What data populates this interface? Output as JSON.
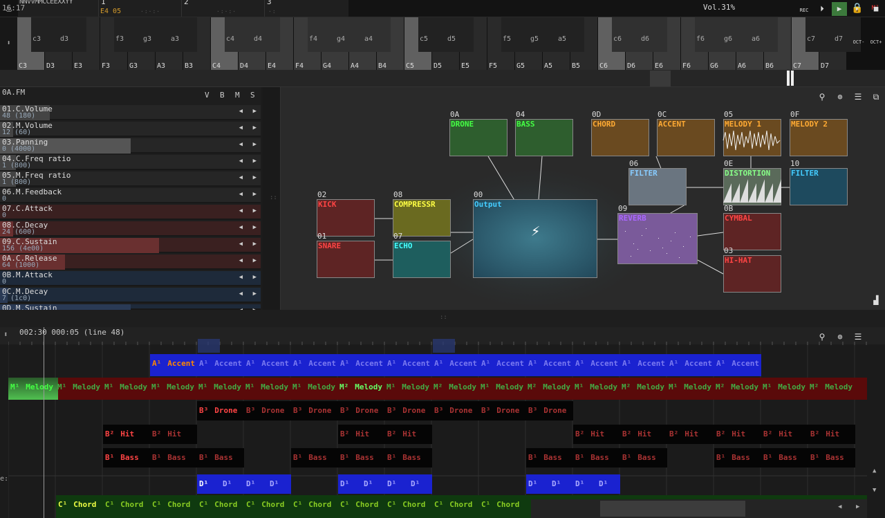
{
  "app": {
    "logo": "sunvox-logo-icon",
    "song_name": "NNVVMMCCEEXXYY",
    "menu_icon": "menu-icon",
    "lock_icon": "lock-icon"
  },
  "tracks": [
    {
      "num": "1",
      "value": "E4   05"
    },
    {
      "num": "2",
      "value": ""
    },
    {
      "num": "3",
      "value": ""
    }
  ],
  "keyboard": {
    "white": [
      "C3",
      "D3",
      "E3",
      "F3",
      "G3",
      "A3",
      "B3",
      "C4",
      "D4",
      "E4",
      "F4",
      "G4",
      "A4",
      "B4",
      "C5",
      "D5",
      "E5",
      "F5",
      "G5",
      "A5",
      "B5",
      "C6",
      "D6",
      "E6",
      "F6",
      "G6",
      "A6",
      "B6",
      "C7",
      "D7"
    ],
    "black": [
      "c3",
      "d3",
      "f3",
      "g3",
      "a3",
      "c4",
      "d4",
      "f4",
      "g4",
      "a4",
      "c5",
      "d5",
      "f5",
      "g5",
      "a5",
      "c6",
      "d6",
      "f6",
      "g6",
      "a6",
      "c7",
      "d7"
    ],
    "oct_down": "OCT-",
    "oct_up": "OCT+"
  },
  "status": {
    "time": "16:17",
    "volume": "Vol.31%",
    "rec": "REC"
  },
  "instrument": {
    "name": "0A.FM",
    "headers": [
      "V",
      "B",
      "M",
      "S"
    ],
    "params": [
      {
        "name": "01.C.Volume",
        "value": "48 (180)",
        "level": 0.19,
        "color": "#444"
      },
      {
        "name": "02.M.Volume",
        "value": "12 (60)",
        "level": 0.05,
        "color": "#444"
      },
      {
        "name": "03.Panning",
        "value": "0 (4000)",
        "level": 0.5,
        "color": "#555"
      },
      {
        "name": "04.C.Freq ratio",
        "value": "1 (800)",
        "level": 0.06,
        "color": "#444"
      },
      {
        "name": "05.M.Freq ratio",
        "value": "1 (800)",
        "level": 0.06,
        "color": "#444"
      },
      {
        "name": "06.M.Feedback",
        "value": "0",
        "level": 0,
        "color": "#444"
      },
      {
        "name": "07.C.Attack",
        "value": "0",
        "level": 0,
        "color": "#6a3030"
      },
      {
        "name": "08.C.Decay",
        "value": "24 (600)",
        "level": 0.05,
        "color": "#6a3030"
      },
      {
        "name": "09.C.Sustain",
        "value": "156 (4e00)",
        "level": 0.61,
        "color": "#6a3030"
      },
      {
        "name": "0A.C.Release",
        "value": "64 (1000)",
        "level": 0.25,
        "color": "#6a3030"
      },
      {
        "name": "0B.M.Attack",
        "value": "0",
        "level": 0,
        "color": "#2a3a55"
      },
      {
        "name": "0C.M.Decay",
        "value": "7 (1c0)",
        "level": 0.03,
        "color": "#2a3a55"
      },
      {
        "name": "0D.M.Sustain",
        "value": "",
        "level": 0.5,
        "color": "#2a3a55"
      }
    ]
  },
  "modules": [
    {
      "id": "0A",
      "name": "DRONE",
      "color": "#2e5e2e",
      "text": "#4f4"
    },
    {
      "id": "04",
      "name": "BASS",
      "color": "#2e5e2e",
      "text": "#4f4"
    },
    {
      "id": "0D",
      "name": "CHORD",
      "color": "#6a4a20",
      "text": "#fa3"
    },
    {
      "id": "0C",
      "name": "ACCENT",
      "color": "#6a4a20",
      "text": "#fa3"
    },
    {
      "id": "05",
      "name": "MELODY 1",
      "color": "#6a4a20",
      "text": "#fa3"
    },
    {
      "id": "0F",
      "name": "MELODY 2",
      "color": "#6a4a20",
      "text": "#fa3"
    },
    {
      "id": "06",
      "name": "FILTER",
      "color": "#6a7580",
      "text": "#8cf"
    },
    {
      "id": "0E",
      "name": "DISTORTION",
      "color": "#5a6a5a",
      "text": "#8f8"
    },
    {
      "id": "10",
      "name": "FILTER",
      "color": "#1e4a5e",
      "text": "#4cf"
    },
    {
      "id": "02",
      "name": "KICK",
      "color": "#5e2424",
      "text": "#f44"
    },
    {
      "id": "08",
      "name": "COMPRESSR",
      "color": "#6a6a20",
      "text": "#ff4"
    },
    {
      "id": "00",
      "name": "Output",
      "color": "#2a5a6a",
      "text": "#4cf"
    },
    {
      "id": "09",
      "name": "REVERB",
      "color": "#7a5a9a",
      "text": "#a6f"
    },
    {
      "id": "0B",
      "name": "CYMBAL",
      "color": "#5e2424",
      "text": "#f44"
    },
    {
      "id": "01",
      "name": "SNARE",
      "color": "#5e2424",
      "text": "#f44"
    },
    {
      "id": "07",
      "name": "ECHO",
      "color": "#1e5e5e",
      "text": "#4ff"
    },
    {
      "id": "03",
      "name": "HI-HAT",
      "color": "#5e2424",
      "text": "#f44"
    }
  ],
  "timeline": {
    "position": "002:30",
    "length": "000:05",
    "line": "(line 48)",
    "track_label": "e:"
  },
  "patterns": {
    "accent": "Accent",
    "melody": "Melody",
    "drone": "Drone",
    "hit": "Hit",
    "bass": "Bass",
    "chord": "Chord",
    "a1": "A¹",
    "m1": "M¹",
    "m2": "M²",
    "b3": "B³",
    "b2": "B²",
    "b1": "B¹",
    "d1": "D¹",
    "c1": "C¹"
  }
}
